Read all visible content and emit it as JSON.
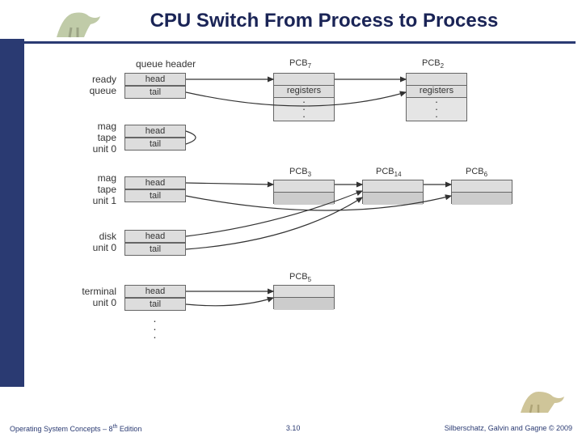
{
  "header": {
    "title": "CPU Switch From Process to Process"
  },
  "footer": {
    "left_pre": "Operating System Concepts – 8",
    "left_sup": "th",
    "left_post": " Edition",
    "center": "3.10",
    "right": "Silberschatz, Galvin and Gagne © 2009"
  },
  "diagram": {
    "col_headers": {
      "queue_header": "queue header"
    },
    "queue_cells": {
      "head": "head",
      "tail": "tail"
    },
    "rows": [
      {
        "label": "ready\nqueue"
      },
      {
        "label": "mag\ntape\nunit 0"
      },
      {
        "label": "mag\ntape\nunit 1"
      },
      {
        "label": "disk\nunit 0"
      },
      {
        "label": "terminal\nunit 0"
      }
    ],
    "pcb_labels": {
      "pcb7": "PCB",
      "pcb7_sub": "7",
      "pcb2": "PCB",
      "pcb2_sub": "2",
      "pcb3": "PCB",
      "pcb3_sub": "3",
      "pcb14": "PCB",
      "pcb14_sub": "14",
      "pcb6": "PCB",
      "pcb6_sub": "6",
      "pcb5": "PCB",
      "pcb5_sub": "5"
    },
    "pcb_field": "registers"
  },
  "colors": {
    "accent": "#2a3a72",
    "box_bg": "#ddd"
  }
}
